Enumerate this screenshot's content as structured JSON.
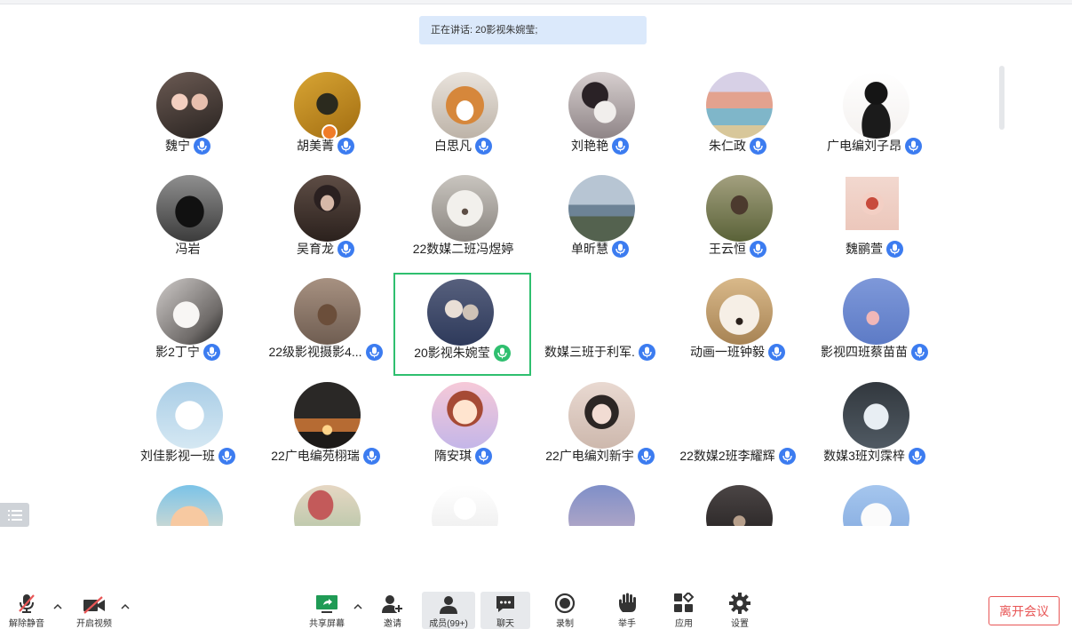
{
  "banner": {
    "speaking_text": "正在讲话: 20影视朱婉莹;"
  },
  "participants": [
    {
      "name": "魏宁",
      "mic": "muted",
      "avatar": "photo-couple"
    },
    {
      "name": "胡美菁",
      "mic": "muted",
      "avatar": "photo-dark-figure"
    },
    {
      "name": "白思凡",
      "mic": "muted",
      "avatar": "photo-corgi"
    },
    {
      "name": "刘艳艳",
      "mic": "muted",
      "avatar": "photo-girl-cat"
    },
    {
      "name": "朱仁政",
      "mic": "muted",
      "avatar": "photo-colorful-street"
    },
    {
      "name": "广电编刘子昂",
      "mic": "muted",
      "avatar": "sketch-boy"
    },
    {
      "name": "冯岩",
      "mic": "none",
      "avatar": "photo-horse-rider"
    },
    {
      "name": "吴育龙",
      "mic": "muted",
      "avatar": "photo-young-man"
    },
    {
      "name": "22数媒二班冯煜婷",
      "mic": "none",
      "avatar": "photo-white-cat"
    },
    {
      "name": "单昕慧",
      "mic": "muted",
      "avatar": "photo-couple-sea"
    },
    {
      "name": "王云恒",
      "mic": "muted",
      "avatar": "photo-figure-grass"
    },
    {
      "name": "魏鹂萱",
      "mic": "muted",
      "avatar": "art-flower-square"
    },
    {
      "name": "影2丁宁",
      "mic": "muted",
      "avatar": "sketch-girl"
    },
    {
      "name": "22级影视摄影4...",
      "mic": "muted",
      "avatar": "photo-brown-figure"
    },
    {
      "name": "20影视朱婉莹",
      "mic": "speaking",
      "avatar": "photo-girl-dogs"
    },
    {
      "name": "数媒三班于利军.",
      "mic": "muted",
      "avatar": "none"
    },
    {
      "name": "动画一班钟毅",
      "mic": "muted",
      "avatar": "photo-smiling-dog"
    },
    {
      "name": "影视四班蔡苗苗",
      "mic": "muted",
      "avatar": "photo-blue-sky"
    },
    {
      "name": "刘佳影视一班",
      "mic": "muted",
      "avatar": "cartoon-crying"
    },
    {
      "name": "22广电编苑栩瑞",
      "mic": "muted",
      "avatar": "photo-sunset"
    },
    {
      "name": "隋安琪",
      "mic": "muted",
      "avatar": "cartoon-girl"
    },
    {
      "name": "22广电编刘新宇",
      "mic": "muted",
      "avatar": "photo-girl-portrait"
    },
    {
      "name": "22数媒2班李耀辉",
      "mic": "muted",
      "avatar": "sketch-crocodile"
    },
    {
      "name": "数媒3班刘霂梓",
      "mic": "muted",
      "avatar": "photo-grey-rabbit"
    },
    {
      "name": "",
      "mic": "none",
      "avatar": "cartoon-face"
    },
    {
      "name": "",
      "mic": "none",
      "avatar": "art-umbrella"
    },
    {
      "name": "",
      "mic": "none",
      "avatar": "manga-character"
    },
    {
      "name": "",
      "mic": "none",
      "avatar": "photo-dusk"
    },
    {
      "name": "",
      "mic": "none",
      "avatar": "photo-dark-street"
    },
    {
      "name": "",
      "mic": "none",
      "avatar": "cartoon-sheep"
    }
  ],
  "toolbar": {
    "unmute": "解除静音",
    "start_video": "开启视频",
    "share_screen": "共享屏幕",
    "invite": "邀请",
    "members": "成员(99+)",
    "chat": "聊天",
    "record": "录制",
    "raise_hand": "举手",
    "apps": "应用",
    "settings": "设置",
    "leave": "离开会议"
  },
  "colors": {
    "accent": "#3c7cf0",
    "speaking": "#2fbf6f",
    "leave": "#e85656",
    "banner_bg": "#dbe9fb"
  }
}
